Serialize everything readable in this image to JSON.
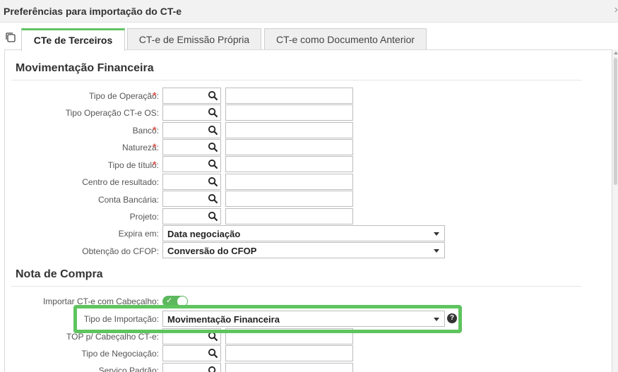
{
  "window": {
    "title": "Preferências para importação do CT-e",
    "close_glyph": "›"
  },
  "icons": {
    "copy": "copy-icon",
    "search": "search-icon",
    "caret": "chevron-down-icon",
    "help": "help-icon"
  },
  "colors": {
    "accent": "#5cb85c",
    "required": "#d9534f",
    "highlight": "#5ec45e"
  },
  "tabs": [
    {
      "label": "CTe de Terceiros",
      "active": true
    },
    {
      "label": "CT-e de Emissão Própria",
      "active": false
    },
    {
      "label": "CT-e como Documento Anterior",
      "active": false
    }
  ],
  "sections": {
    "financeira": "Movimentação Financeira",
    "compra": "Nota de Compra"
  },
  "required_mark": "*",
  "fields": {
    "tipo_operacao": {
      "label": "Tipo de Operação:",
      "code": "",
      "description": ""
    },
    "tipo_operacao_os": {
      "label": "Tipo Operação CT-e OS:",
      "code": "",
      "description": ""
    },
    "banco": {
      "label": "Banco:",
      "code": "",
      "description": ""
    },
    "natureza": {
      "label": "Natureza:",
      "code": "",
      "description": ""
    },
    "tipo_titulo": {
      "label": "Tipo de título:",
      "code": "",
      "description": ""
    },
    "centro_resultado": {
      "label": "Centro de resultado:",
      "code": "",
      "description": ""
    },
    "conta_bancaria": {
      "label": "Conta Bancária:",
      "code": "",
      "description": ""
    },
    "projeto": {
      "label": "Projeto:",
      "code": "",
      "description": ""
    },
    "expira_em": {
      "label": "Expira em:",
      "value": "Data negociação"
    },
    "obtencao_cfop": {
      "label": "Obtenção do CFOP:",
      "value": "Conversão do CFOP"
    },
    "importar_cabecalho": {
      "label": "Importar CT-e com Cabeçalho:",
      "checked": true,
      "check_glyph": "✓"
    },
    "tipo_importacao": {
      "label": "Tipo de Importação:",
      "value": "Movimentação Financeira"
    },
    "top_cabecalho": {
      "label": "TOP p/ Cabeçalho CT-e:",
      "code": "",
      "description": ""
    },
    "tipo_negociacao": {
      "label": "Tipo de Negociação:",
      "code": "",
      "description": ""
    },
    "servico_padrao": {
      "label": "Serviço Padrão:"
    }
  },
  "help_glyph": "?"
}
